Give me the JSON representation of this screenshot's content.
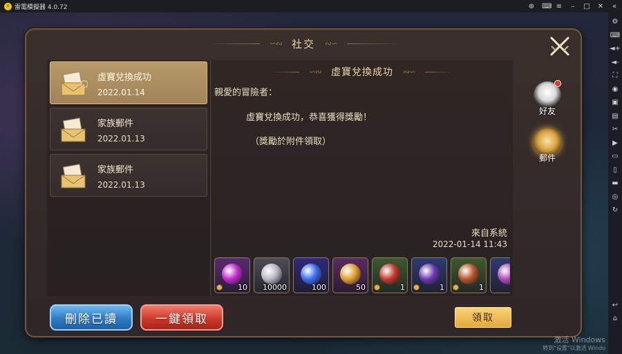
{
  "emulator": {
    "title": "雷電模擬器 4.0.72",
    "top_controls": [
      "gamepad-icon",
      "keyboard-icon",
      "menu-icon",
      "minimize-icon",
      "maximize-icon",
      "close-icon",
      "collapse-icon"
    ],
    "side_tools": [
      "settings-icon",
      "keymap-icon",
      "volume-up-icon",
      "volume-down-icon",
      "screenshot-icon",
      "record-icon",
      "install-apk-icon",
      "performance-icon",
      "scissors-icon",
      "video-icon",
      "sync-icon",
      "rotate-icon",
      "folder-icon",
      "location-icon",
      "shake-icon"
    ],
    "side_bottom": [
      "back-icon",
      "home-icon"
    ]
  },
  "panel": {
    "title": "社交",
    "mails": [
      {
        "subject": "虛寶兌換成功",
        "date": "2022.01.14",
        "active": true
      },
      {
        "subject": "家族郵件",
        "date": "2022.01.13",
        "active": false
      },
      {
        "subject": "家族郵件",
        "date": "2022.01.13",
        "active": false
      }
    ],
    "content": {
      "title": "虛寶兌換成功",
      "greeting": "親愛的冒險者：",
      "line1": "虛寶兌換成功，恭喜獲得獎勵！",
      "line2": "（獎勵於附件領取）",
      "sender": "來自系統",
      "time": "2022-01-14  11:43"
    },
    "attachments": [
      {
        "qty": "10",
        "color": "#c02cc8",
        "bg": "#5a2a70",
        "locked": true
      },
      {
        "qty": "10000",
        "color": "#b8b8c2",
        "bg": "#4d4d58",
        "locked": false
      },
      {
        "qty": "100",
        "color": "#3a6ef0",
        "bg": "#302a78",
        "locked": false
      },
      {
        "qty": "50",
        "color": "#e0a030",
        "bg": "#5a2a60",
        "locked": false
      },
      {
        "qty": "1",
        "color": "#c23a2a",
        "bg": "#3d5a2e",
        "locked": true
      },
      {
        "qty": "1",
        "color": "#6a3ab0",
        "bg": "#2e3a70",
        "locked": true
      },
      {
        "qty": "1",
        "color": "#b5552a",
        "bg": "#3d5a2e",
        "locked": true
      },
      {
        "qty": "",
        "color": "#b04ab8",
        "bg": "#2e3a70",
        "locked": false
      }
    ],
    "buttons": {
      "delete_read": "刪除已讀",
      "claim_all": "一鍵領取",
      "claim": "領取"
    }
  },
  "side_tabs": {
    "friends": "好友",
    "mail": "郵件"
  },
  "watermark": {
    "line1": "激活 Windows",
    "line2": "转到\"设置\"以激活 Windo"
  }
}
